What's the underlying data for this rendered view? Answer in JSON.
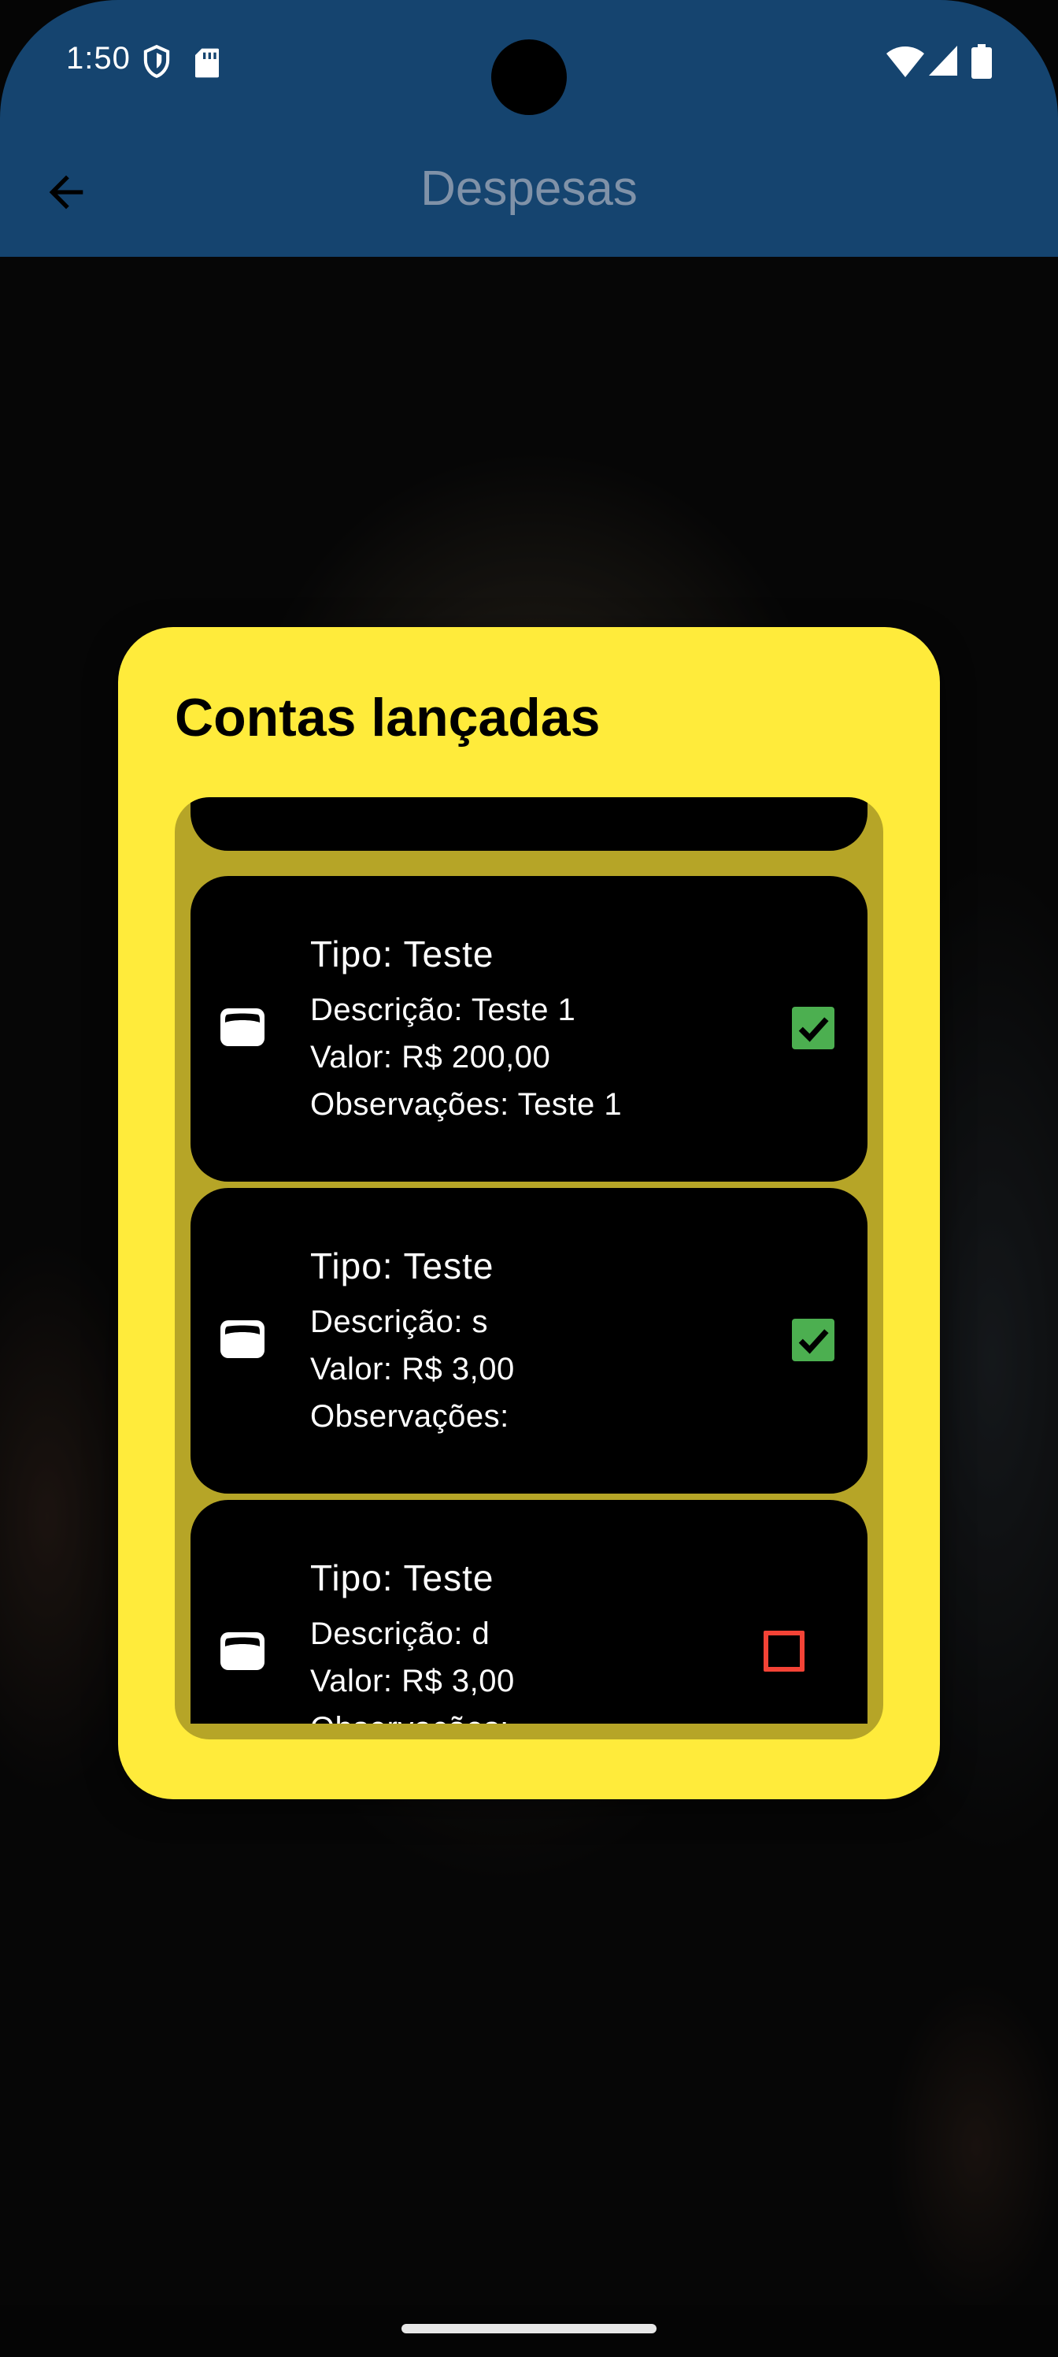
{
  "status_bar": {
    "time": "1:50"
  },
  "app_bar": {
    "title": "Despesas"
  },
  "dialog": {
    "title": "Contas lançadas",
    "items": [
      {
        "tipo": "Tipo: Teste",
        "descricao": "Descrição: Teste 1",
        "valor": "Valor: R$ 200,00",
        "observacoes": "Observações: Teste 1",
        "checked": true
      },
      {
        "tipo": "Tipo: Teste",
        "descricao": "Descrição: s",
        "valor": "Valor: R$ 3,00",
        "observacoes": "Observações:",
        "checked": true
      },
      {
        "tipo": "Tipo: Teste",
        "descricao": "Descrição: d",
        "valor": "Valor: R$ 3,00",
        "observacoes": "Observações:",
        "checked": false
      }
    ]
  },
  "colors": {
    "app_bar": "#15446f",
    "dialog": "#ffeb3b",
    "list_background": "#b6a527",
    "card": "#000000",
    "checked": "#4caf50",
    "unchecked": "#f44336"
  },
  "icons": {
    "back": "arrow-back-icon",
    "item": "wallet-icon",
    "checked": "checkbox-checked-icon",
    "unchecked": "checkbox-unchecked-icon"
  }
}
